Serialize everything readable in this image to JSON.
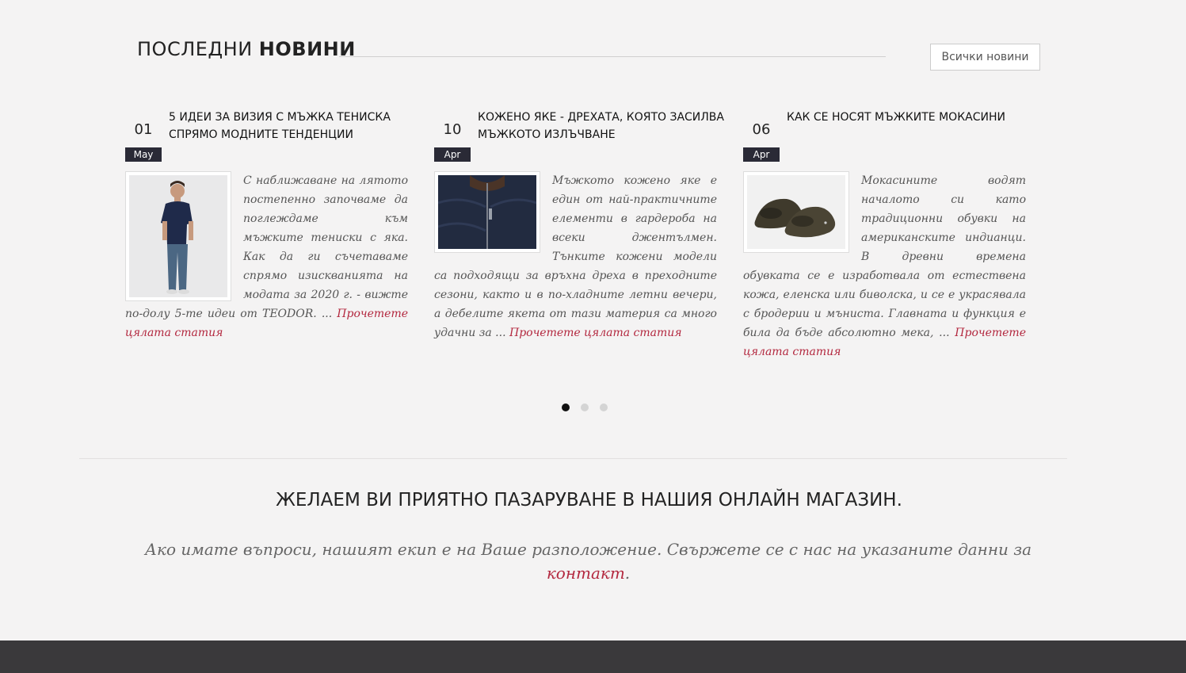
{
  "news": {
    "title_light": "ПОСЛЕДНИ",
    "title_bold": "НОВИНИ",
    "all_news_label": "Всички новини",
    "articles": [
      {
        "day": "01",
        "month": "May",
        "title": "5 идеи за визия с мъжка тениска спрямо модните тенденции",
        "excerpt": "С наближаване на лятото постепенно започваме да поглеждаме към мъжките тениски с яка. Как да ги съчетаваме спрямо изискванията на модата за 2020 г. - вижте по-долу 5-те идеи от TEODOR. ...",
        "read_more": "Прочетете цялата статия",
        "image": "man-in-navy-polo-and-jeans"
      },
      {
        "day": "10",
        "month": "Apr",
        "title": "Кожено яке - дрехата, която засилва мъжкото излъчване",
        "excerpt": "Мъжкото кожено яке е един от най-практичните елементи в гардероба на всеки джентълмен. Тънките кожени модели са подходящи за връхна дреха в преходните сезони, както и в по-хладните летни вечери, а дебелите якета от тази материя са много удачни за ...",
        "read_more": "Прочетете цялата статия",
        "image": "navy-leather-jacket"
      },
      {
        "day": "06",
        "month": "Apr",
        "title": "Как се носят мъжките мокасини",
        "excerpt": "Мокасините водят началото си като традиционни обувки на американските индианци. В древни времена обувката се е изработвала от естествена кожа, еленска или биволска, и се е украсявала с бродерии и мъниста. Главната и функция е била да бъде абсолютно мека, ...",
        "read_more": "Прочетете цялата статия",
        "image": "brown-suede-moccasins"
      }
    ],
    "carousel_pages": 3,
    "carousel_active": 1
  },
  "closing": {
    "wish": "ЖЕЛАЕМ ВИ ПРИЯТНО ПАЗАРУВАНЕ В НАШИЯ ОНЛАЙН МАГАЗИН.",
    "contact_text": "Ако имате въпроси, нашият екип е на Ваше разположение. Свържете се с нас на указаните данни за ",
    "contact_link": "контакт",
    "contact_end": "."
  },
  "colors": {
    "accent": "#b3283f",
    "date_badge": "#2a2a36",
    "footer": "#3a393b",
    "background": "#f4f3f3"
  }
}
